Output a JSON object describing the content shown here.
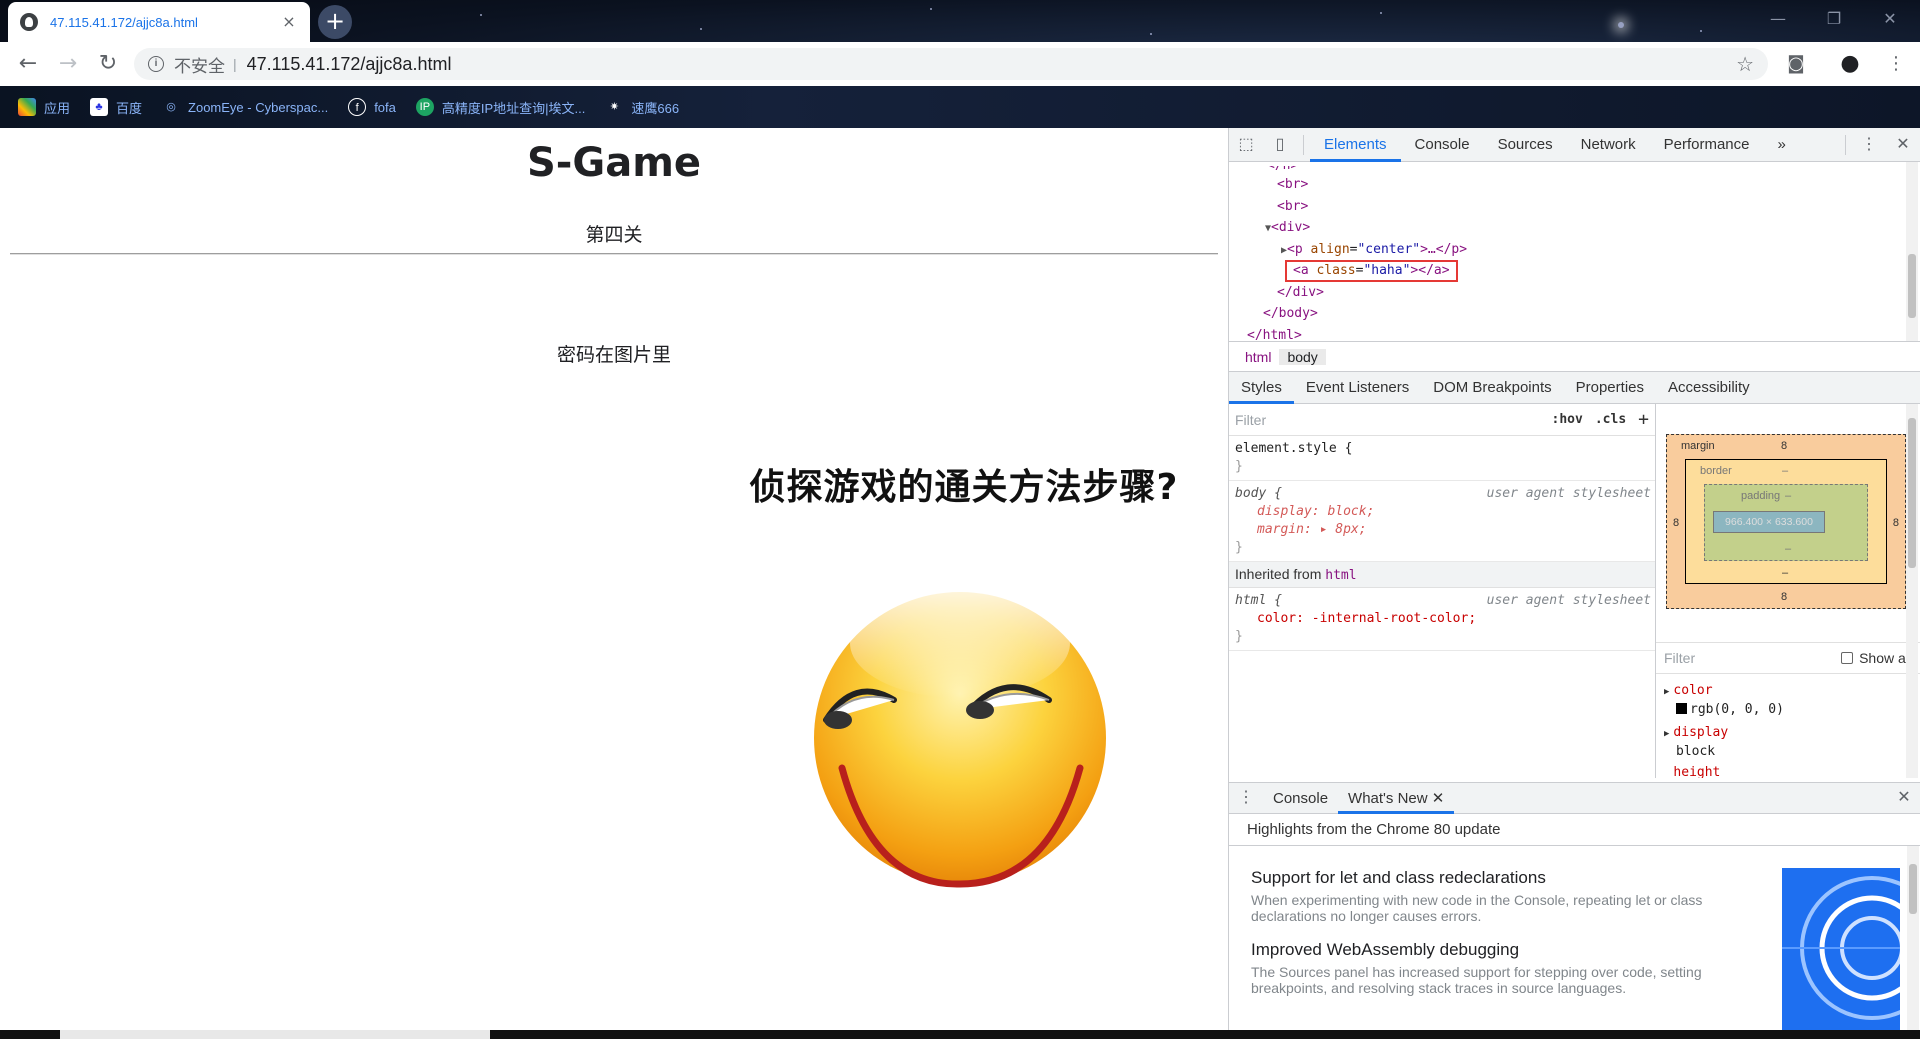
{
  "browser": {
    "tab_title": "47.115.41.172/ajjc8a.html",
    "tab_close": "×",
    "newtab": "+",
    "insecure_label": "不安全",
    "url": "47.115.41.172/ajjc8a.html"
  },
  "bookmarks": [
    {
      "label": "应用",
      "icon": "apps-grid-icon"
    },
    {
      "label": "百度",
      "icon": "baidu-icon"
    },
    {
      "label": "ZoomEye - Cyberspac...",
      "icon": "zoomeye-icon"
    },
    {
      "label": "fofa",
      "icon": "fofa-icon"
    },
    {
      "label": "高精度IP地址查询|埃文...",
      "icon": "ip-icon"
    },
    {
      "label": "速鹰666",
      "icon": "eagle-icon"
    }
  ],
  "page": {
    "title": "S-Game",
    "level": "第四关",
    "hint": "密码在图片里",
    "meme_caption": "侦探游戏的通关方法步骤?"
  },
  "devtools": {
    "tabs": [
      "Elements",
      "Console",
      "Sources",
      "Network",
      "Performance"
    ],
    "more": "»",
    "dom_lines": {
      "br1": "<br>",
      "br2": "<br>",
      "div_open": "<div>",
      "p_tag": "<p",
      "p_attr": "align",
      "p_val": "\"center\"",
      "p_close": ">…</p>",
      "a_tag": "<a",
      "a_attr": "class",
      "a_val": "\"haha\"",
      "a_close": "></a>",
      "div_close": "</div>",
      "body_close": "</body>",
      "html_close": "</html>"
    },
    "crumbs": [
      "html",
      "body"
    ],
    "styles_tabs": [
      "Styles",
      "Event Listeners",
      "DOM Breakpoints",
      "Properties",
      "Accessibility"
    ],
    "filter_placeholder": "Filter",
    "hov": ":hov",
    "cls": ".cls",
    "element_style": "element.style {",
    "body_rule": {
      "selector": "body {",
      "source": "user agent stylesheet",
      "display": "display: block;",
      "margin": "margin: ▸ 8px;"
    },
    "inherited_label": "Inherited from",
    "inherited_tag": "html",
    "html_rule": {
      "selector": "html {",
      "source": "user agent stylesheet",
      "color": "color: -internal-root-color;"
    },
    "boxmodel": {
      "margin_label": "margin",
      "margin_val": "8",
      "border_label": "border",
      "padding_label": "padding",
      "dash": "–",
      "content": "966.400 × 633.600",
      "side": "8"
    },
    "computed_filter": "Filter",
    "show_all": "Show all",
    "computed": [
      {
        "name": "color",
        "value": "rgb(0, 0, 0)"
      },
      {
        "name": "display",
        "value": "block"
      },
      {
        "name": "height",
        "value": ""
      }
    ],
    "drawer_tabs": [
      "Console",
      "What's New"
    ],
    "drawer_subtitle": "Highlights from the Chrome 80 update",
    "whatsnew": [
      {
        "title": "Support for let and class redeclarations",
        "desc": "When experimenting with new code in the Console, repeating let or class declarations no longer causes errors."
      },
      {
        "title": "Improved WebAssembly debugging",
        "desc": "The Sources panel has increased support for stepping over code, setting breakpoints, and resolving stack traces in source languages."
      }
    ]
  }
}
